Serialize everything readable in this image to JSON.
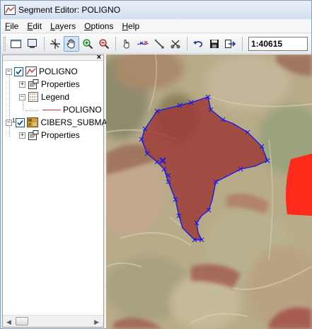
{
  "window": {
    "title": "Segment Editor: POLIGNO"
  },
  "menu": {
    "items": [
      {
        "underline": "F",
        "rest": "ile"
      },
      {
        "underline": "E",
        "rest": "dit"
      },
      {
        "underline": "L",
        "rest": "ayers"
      },
      {
        "underline": "O",
        "rest": "ptions"
      },
      {
        "underline": "H",
        "rest": "elp"
      }
    ]
  },
  "toolbar": {
    "scale": "1:40615",
    "icons": [
      "new-view-icon",
      "zoom-extent-icon",
      "select-arrow-icon",
      "pan-hand-icon",
      "zoom-in-icon",
      "zoom-out-icon",
      "identify-hand-icon",
      "add-vertex-icon",
      "draw-line-icon",
      "delete-vertex-icon",
      "undo-icon",
      "save-icon",
      "exit-icon"
    ]
  },
  "layers": {
    "close_glyph": "×",
    "layer1": {
      "name": "POLIGNO",
      "properties": "Properties",
      "legend": "Legend",
      "legend_entry": "POLIGNO",
      "line_color": "#e03030"
    },
    "layer2": {
      "name": "CIBERS_SUBMA",
      "marker": "1",
      "properties": "Properties"
    }
  },
  "map": {
    "polygon_color": "#1a1ae6",
    "highlight_color": "#ff2a1a"
  }
}
